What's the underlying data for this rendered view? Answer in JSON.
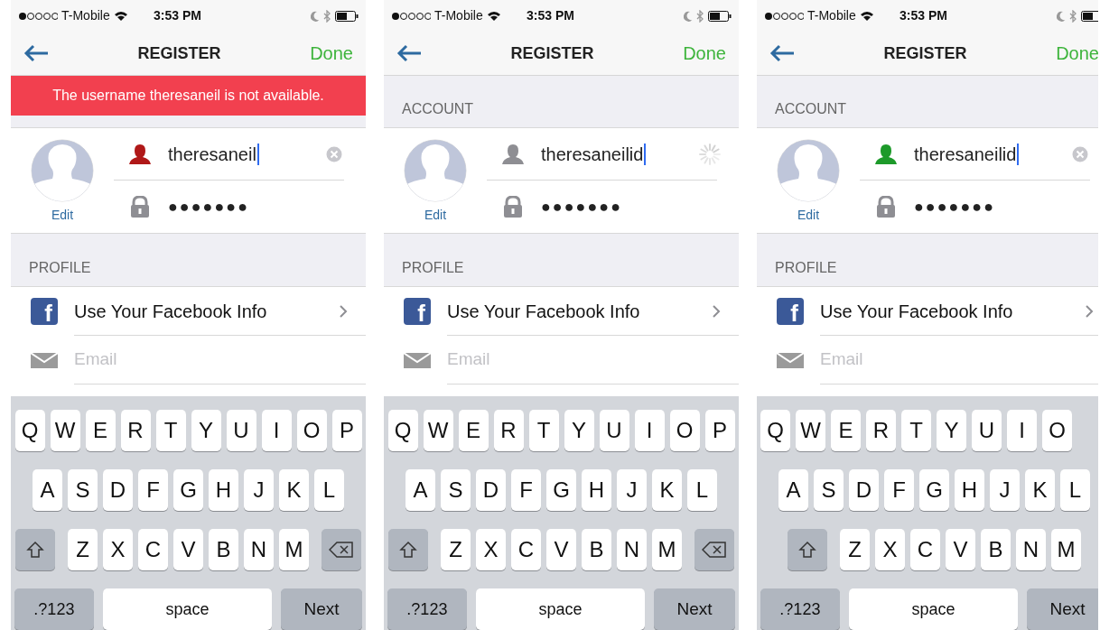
{
  "screens": [
    {
      "status_bar": {
        "carrier": "T-Mobile",
        "time": "3:53 PM"
      },
      "nav": {
        "title": "REGISTER",
        "action": "Done"
      },
      "banner": "The username theresaneil is not available.",
      "avatar": {
        "edit": "Edit"
      },
      "username": {
        "value": "theresaneil",
        "kind": "error"
      },
      "password": {
        "value": "●●●●●●●"
      },
      "profile_header": "PROFILE",
      "facebook": {
        "glyph": "f",
        "label": "Use Your Facebook Info"
      },
      "email": {
        "placeholder": "Email"
      },
      "keyboard": [
        [
          {
            "kind": "key",
            "label": "Q"
          },
          {
            "kind": "key",
            "label": "W"
          },
          {
            "kind": "key",
            "label": "E"
          },
          {
            "kind": "key",
            "label": "R"
          },
          {
            "kind": "key",
            "label": "T"
          },
          {
            "kind": "key",
            "label": "Y"
          },
          {
            "kind": "key",
            "label": "U"
          },
          {
            "kind": "key",
            "label": "I"
          },
          {
            "kind": "key",
            "label": "O"
          },
          {
            "kind": "key",
            "label": "P"
          }
        ],
        [
          {
            "kind": "key",
            "label": "A"
          },
          {
            "kind": "key",
            "label": "S"
          },
          {
            "kind": "key",
            "label": "D"
          },
          {
            "kind": "key",
            "label": "F"
          },
          {
            "kind": "key",
            "label": "G"
          },
          {
            "kind": "key",
            "label": "H"
          },
          {
            "kind": "key",
            "label": "J"
          },
          {
            "kind": "key",
            "label": "K"
          },
          {
            "kind": "key",
            "label": "L"
          }
        ],
        [
          {
            "kind": "shift"
          },
          {
            "kind": "key",
            "label": "Z"
          },
          {
            "kind": "key",
            "label": "X"
          },
          {
            "kind": "key",
            "label": "C"
          },
          {
            "kind": "key",
            "label": "V"
          },
          {
            "kind": "key",
            "label": "B"
          },
          {
            "kind": "key",
            "label": "N"
          },
          {
            "kind": "key",
            "label": "M"
          },
          {
            "kind": "backspace"
          }
        ],
        [
          {
            "kind": "mode",
            "label": ".?123"
          },
          {
            "kind": "space",
            "label": "space"
          },
          {
            "kind": "action",
            "label": "Next"
          }
        ]
      ]
    },
    {
      "status_bar": {
        "carrier": "T-Mobile",
        "time": "3:53 PM"
      },
      "nav": {
        "title": "REGISTER",
        "action": "Done"
      },
      "account_header": "ACCOUNT",
      "avatar": {
        "edit": "Edit"
      },
      "username": {
        "value": "theresaneilid",
        "kind": "checking"
      },
      "password": {
        "value": "●●●●●●●"
      },
      "profile_header": "PROFILE",
      "facebook": {
        "glyph": "f",
        "label": "Use Your Facebook Info"
      },
      "email": {
        "placeholder": "Email"
      },
      "keyboard": [
        [
          {
            "kind": "key",
            "label": "Q"
          },
          {
            "kind": "key",
            "label": "W"
          },
          {
            "kind": "key",
            "label": "E"
          },
          {
            "kind": "key",
            "label": "R"
          },
          {
            "kind": "key",
            "label": "T"
          },
          {
            "kind": "key",
            "label": "Y"
          },
          {
            "kind": "key",
            "label": "U"
          },
          {
            "kind": "key",
            "label": "I"
          },
          {
            "kind": "key",
            "label": "O"
          },
          {
            "kind": "key",
            "label": "P"
          }
        ],
        [
          {
            "kind": "key",
            "label": "A"
          },
          {
            "kind": "key",
            "label": "S"
          },
          {
            "kind": "key",
            "label": "D"
          },
          {
            "kind": "key",
            "label": "F"
          },
          {
            "kind": "key",
            "label": "G"
          },
          {
            "kind": "key",
            "label": "H"
          },
          {
            "kind": "key",
            "label": "J"
          },
          {
            "kind": "key",
            "label": "K"
          },
          {
            "kind": "key",
            "label": "L"
          }
        ],
        [
          {
            "kind": "shift"
          },
          {
            "kind": "key",
            "label": "Z"
          },
          {
            "kind": "key",
            "label": "X"
          },
          {
            "kind": "key",
            "label": "C"
          },
          {
            "kind": "key",
            "label": "V"
          },
          {
            "kind": "key",
            "label": "B"
          },
          {
            "kind": "key",
            "label": "N"
          },
          {
            "kind": "key",
            "label": "M"
          },
          {
            "kind": "backspace"
          }
        ],
        [
          {
            "kind": "mode",
            "label": ".?123"
          },
          {
            "kind": "space",
            "label": "space"
          },
          {
            "kind": "action",
            "label": "Next"
          }
        ]
      ]
    },
    {
      "status_bar": {
        "carrier": "T-Mobile",
        "time": "3:53 PM"
      },
      "nav": {
        "title": "REGISTER",
        "action": "Done"
      },
      "account_header": "ACCOUNT",
      "avatar": {
        "edit": "Edit"
      },
      "username": {
        "value": "theresaneilid",
        "kind": "available"
      },
      "password": {
        "value": "●●●●●●●"
      },
      "profile_header": "PROFILE",
      "facebook": {
        "glyph": "f",
        "label": "Use Your Facebook Info"
      },
      "email": {
        "placeholder": "Email"
      },
      "keyboard": [
        [
          {
            "kind": "key",
            "label": "Q"
          },
          {
            "kind": "key",
            "label": "W"
          },
          {
            "kind": "key",
            "label": "E"
          },
          {
            "kind": "key",
            "label": "R"
          },
          {
            "kind": "key",
            "label": "T"
          },
          {
            "kind": "key",
            "label": "Y"
          },
          {
            "kind": "key",
            "label": "U"
          },
          {
            "kind": "key",
            "label": "I"
          },
          {
            "kind": "key",
            "label": "O"
          }
        ],
        [
          {
            "kind": "key",
            "label": "A"
          },
          {
            "kind": "key",
            "label": "S"
          },
          {
            "kind": "key",
            "label": "D"
          },
          {
            "kind": "key",
            "label": "F"
          },
          {
            "kind": "key",
            "label": "G"
          },
          {
            "kind": "key",
            "label": "H"
          },
          {
            "kind": "key",
            "label": "J"
          },
          {
            "kind": "key",
            "label": "K"
          },
          {
            "kind": "key",
            "label": "L"
          }
        ],
        [
          {
            "kind": "shift"
          },
          {
            "kind": "key",
            "label": "Z"
          },
          {
            "kind": "key",
            "label": "X"
          },
          {
            "kind": "key",
            "label": "C"
          },
          {
            "kind": "key",
            "label": "V"
          },
          {
            "kind": "key",
            "label": "B"
          },
          {
            "kind": "key",
            "label": "N"
          },
          {
            "kind": "key",
            "label": "M"
          }
        ],
        [
          {
            "kind": "mode",
            "label": ".?123"
          },
          {
            "kind": "space",
            "label": "space"
          },
          {
            "kind": "action",
            "label": "Next"
          }
        ]
      ]
    }
  ]
}
